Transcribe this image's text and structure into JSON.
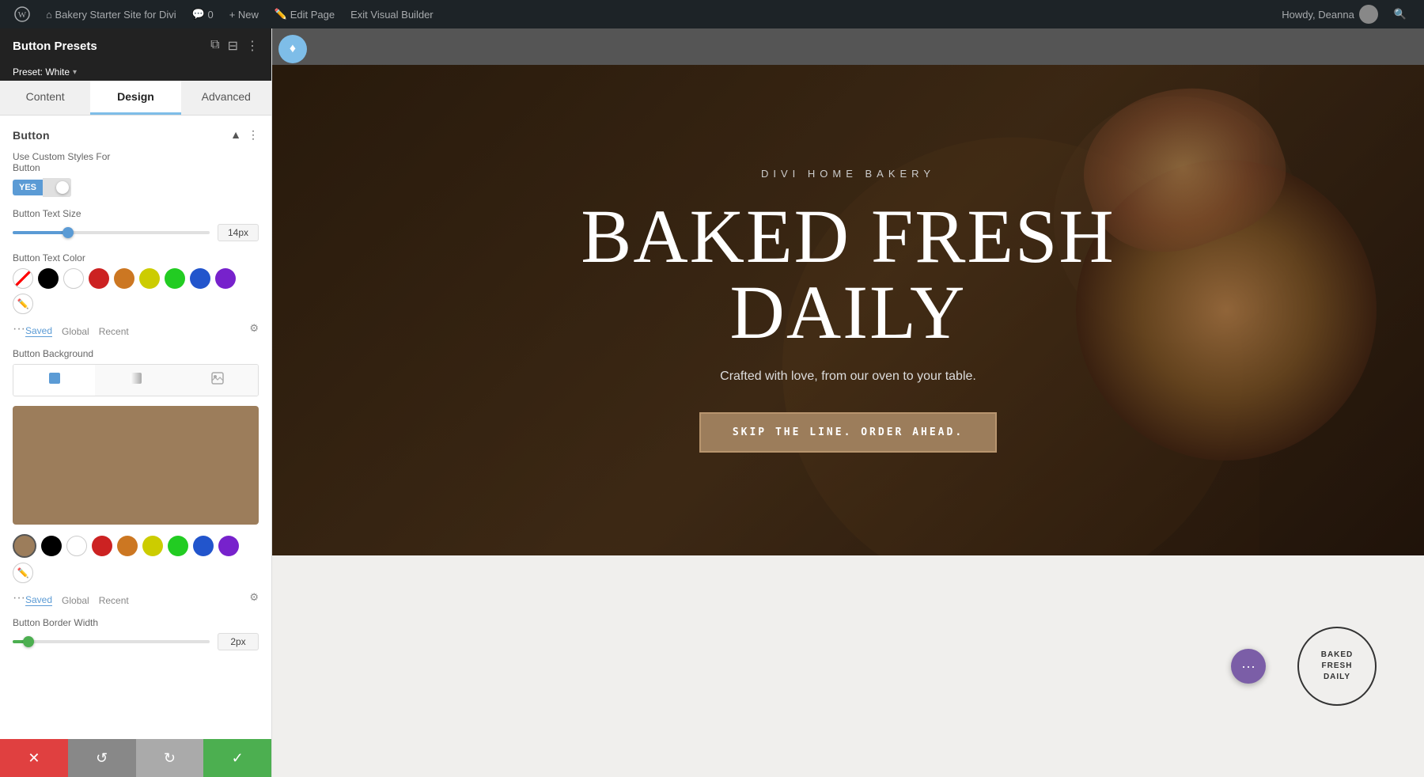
{
  "admin_bar": {
    "wp_label": "⊞",
    "items": [
      {
        "label": "Bakery Starter Site for Divi",
        "icon": "🏠"
      },
      {
        "label": "0",
        "icon": "💬"
      },
      {
        "label": "+ New",
        "icon": ""
      },
      {
        "label": "Edit Page",
        "icon": "✏️"
      },
      {
        "label": "Exit Visual Builder",
        "icon": ""
      }
    ],
    "right": {
      "label": "Howdy, Deanna"
    }
  },
  "panel": {
    "title": "Button Presets",
    "preset": "Preset: White",
    "preset_arrow": "▾",
    "icons": {
      "duplicate": "⧉",
      "collapse": "⊟",
      "more": "⋮"
    },
    "tabs": [
      {
        "label": "Content",
        "id": "content"
      },
      {
        "label": "Design",
        "id": "design"
      },
      {
        "label": "Advanced",
        "id": "advanced"
      }
    ],
    "active_tab": "design",
    "section": {
      "title": "Button",
      "arrow": "▲",
      "dots": "⋮"
    },
    "fields": {
      "custom_styles_label": "Use Custom Styles For\nButton",
      "toggle_yes": "YES",
      "text_size_label": "Button Text Size",
      "text_size_value": "14px",
      "text_size_percent": 28,
      "text_color_label": "Button Text Color",
      "colors": [
        {
          "value": "#000000"
        },
        {
          "value": "#ffffff"
        },
        {
          "value": "#cc2222"
        },
        {
          "value": "#cc7722"
        },
        {
          "value": "#cccc00"
        },
        {
          "value": "#22cc22"
        },
        {
          "value": "#2255cc"
        },
        {
          "value": "#7722cc"
        },
        {
          "value": "pencil"
        }
      ],
      "color_tabs": [
        "Saved",
        "Global",
        "Recent"
      ],
      "bg_label": "Button Background",
      "bg_types": [
        "solid",
        "gradient",
        "image"
      ],
      "color_preview": "#9c7d5b",
      "bottom_colors": [
        {
          "value": "#9c7d5b",
          "active": true
        },
        {
          "value": "#000000"
        },
        {
          "value": "#ffffff"
        },
        {
          "value": "#cc2222"
        },
        {
          "value": "#cc7722"
        },
        {
          "value": "#cccc00"
        },
        {
          "value": "#22cc22"
        },
        {
          "value": "#2255cc"
        },
        {
          "value": "#7722cc"
        },
        {
          "value": "pencil"
        }
      ],
      "border_width_label": "Button Border Width",
      "border_width_value": "2px",
      "border_width_percent": 8
    }
  },
  "divi_bar": {
    "logo": "♦",
    "site_label": "Bakery Starter Site for Divi",
    "comment_count": "0",
    "new_label": "+ New",
    "edit_label": "Edit Page",
    "exit_label": "Exit Visual Builder"
  },
  "hero": {
    "subtitle": "DIVI HOME BAKERY",
    "title_line1": "BAKED FRESH",
    "title_line2": "DAILY",
    "tagline": "Crafted with love, from our oven to your table.",
    "button_text": "SKIP THE LINE. ORDER AHEAD.",
    "button_color": "#9c7d5b"
  },
  "below_hero": {
    "stamp_text": "BAKED\nFRESH\nDAILY",
    "fab_icon": "•••"
  },
  "footer": {
    "close_icon": "✕",
    "undo_icon": "↺",
    "redo_icon": "↻",
    "confirm_icon": "✓"
  }
}
